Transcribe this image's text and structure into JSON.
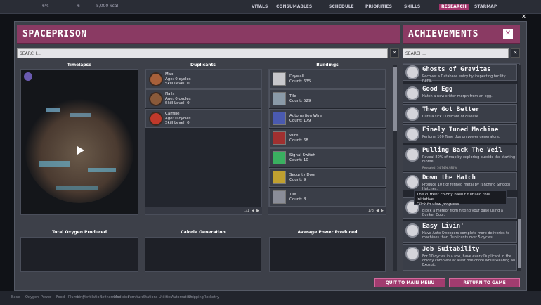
{
  "hud": {
    "stat_a": "6%",
    "stat_b": "6",
    "stat_c": "5,000 kcal",
    "tabs": [
      "VITALS",
      "CONSUMABLES",
      "SCHEDULE",
      "PRIORITIES",
      "SKILLS",
      "RESEARCH",
      "STARMAP"
    ],
    "bottom_items": [
      "Base",
      "Oxygen",
      "Power",
      "Food",
      "Plumbing",
      "Ventilation",
      "Refinement",
      "Medicine",
      "Furniture",
      "Stations",
      "Utilities",
      "Automation",
      "Shipping",
      "Rocketry"
    ]
  },
  "main": {
    "title": "SPACEPRISON",
    "search_placeholder": "SEARCH...",
    "search_close": "✕",
    "columns": {
      "timelapse": "Timelapse",
      "duplicants": "Duplicants",
      "buildings": "Buildings"
    },
    "duplicants": [
      {
        "name": "Max",
        "age": "Age: 0 cycles",
        "skill": "Skill Level: 0",
        "color": "#a8603a"
      },
      {
        "name": "Nails",
        "age": "Age: 0 cycles",
        "skill": "Skill Level: 0",
        "color": "#8a5a3a"
      },
      {
        "name": "Camille",
        "age": "Age: 0 cycles",
        "skill": "Skill Level: 0",
        "color": "#c0392b"
      }
    ],
    "duplicants_pager": "1/1",
    "buildings": [
      {
        "name": "Drywall",
        "count": "Count: 635"
      },
      {
        "name": "Tile",
        "count": "Count: 529"
      },
      {
        "name": "Automation Wire",
        "count": "Count: 179"
      },
      {
        "name": "Wire",
        "count": "Count: 68"
      },
      {
        "name": "Signal Switch",
        "count": "Count: 10"
      },
      {
        "name": "Security Door",
        "count": "Count: 9"
      },
      {
        "name": "Tile",
        "count": "Count: 8"
      }
    ],
    "buildings_pager": "1/3",
    "charts": {
      "oxygen": "Total Oxygen Produced",
      "calorie": "Calorie Generation",
      "power": "Average Power Produced"
    },
    "buttons": {
      "quit": "QUIT TO MAIN MENU",
      "return": "RETURN TO GAME"
    }
  },
  "achievements": {
    "title": "ACHIEVEMENTS",
    "search_placeholder": "SEARCH...",
    "close": "✕",
    "items": [
      {
        "name": "Ghosts of Gravitas",
        "desc": "Recover a Database entry by inspecting facility ruins."
      },
      {
        "name": "Good Egg",
        "desc": "Hatch a new critter morph from an egg."
      },
      {
        "name": "They Got Better",
        "desc": "Cure a sick Duplicant of disease."
      },
      {
        "name": "Finely Tuned Machine",
        "desc": "Perform 100 Tune Ups on power generators."
      },
      {
        "name": "Pulling Back The Veil",
        "desc": "Reveal 80% of map by exploring outside the starting biome.",
        "progress": "Revealed: 54.74% / 80%"
      },
      {
        "name": "Down the Hatch",
        "desc": "Produce 10 t of refined metal by ranching Smooth Hatches."
      },
      {
        "name": "",
        "desc": "Block a meteor from hitting your base using a Bunker Door."
      },
      {
        "name": "Easy Livin'",
        "desc": "Have Auto-Sweepers complete more deliveries to machines than Duplicants over 5 cycles."
      },
      {
        "name": "Job Suitability",
        "desc": "For 10 cycles in a row, have every Duplicant in the colony complete at least one chore while wearing an Exosuit."
      }
    ],
    "tooltip_line1": "The current colony hasn't fulfilled this Initiative",
    "tooltip_line2": "Click to view progress"
  },
  "colors": {
    "accent": "#8a3a63",
    "button": "#a13c6f"
  }
}
